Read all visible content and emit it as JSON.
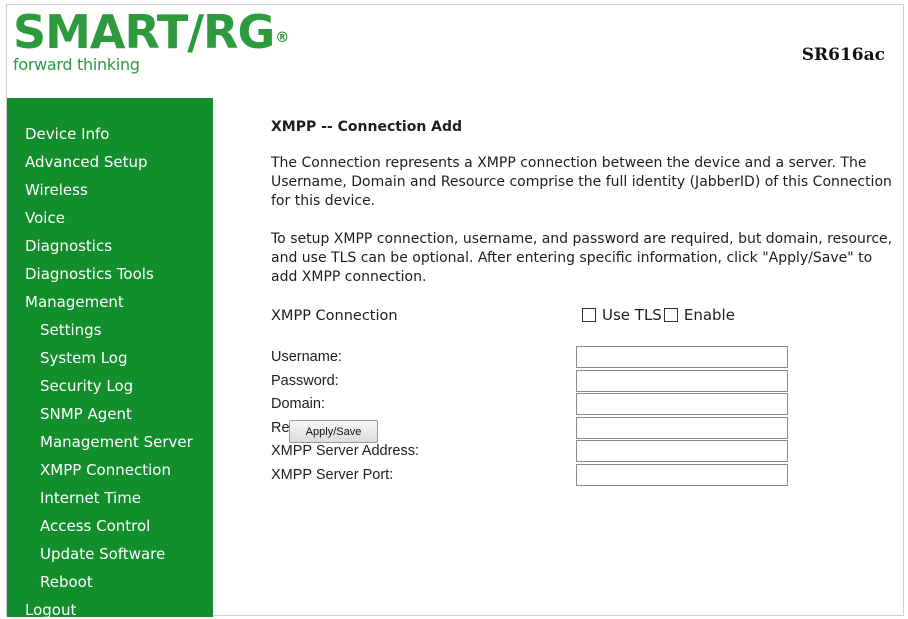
{
  "header": {
    "logo_text": "SMART/RG",
    "logo_mark": "®",
    "tagline": "forward thinking",
    "model": "SR616ac"
  },
  "sidebar": {
    "items": [
      {
        "label": "Device Info",
        "level": 0
      },
      {
        "label": "Advanced Setup",
        "level": 0
      },
      {
        "label": "Wireless",
        "level": 0
      },
      {
        "label": "Voice",
        "level": 0
      },
      {
        "label": "Diagnostics",
        "level": 0
      },
      {
        "label": "Diagnostics Tools",
        "level": 0
      },
      {
        "label": "Management",
        "level": 0
      },
      {
        "label": "Settings",
        "level": 1
      },
      {
        "label": "System Log",
        "level": 1
      },
      {
        "label": "Security Log",
        "level": 1
      },
      {
        "label": "SNMP Agent",
        "level": 1
      },
      {
        "label": "Management Server",
        "level": 1
      },
      {
        "label": "XMPP Connection",
        "level": 1
      },
      {
        "label": "Internet Time",
        "level": 1
      },
      {
        "label": "Access Control",
        "level": 1
      },
      {
        "label": "Update Software",
        "level": 1
      },
      {
        "label": "Reboot",
        "level": 1
      },
      {
        "label": "Logout",
        "level": 0
      }
    ]
  },
  "main": {
    "title": "XMPP -- Connection Add",
    "paragraph1": "The Connection represents a XMPP connection between the device and a server. The Username, Domain and Resource comprise the full identity (JabberID) of this Connection for this device.",
    "paragraph2": "To setup XMPP connection, username, and password are required, but domain, resource, and use TLS can be optional. After entering specific information, click \"Apply/Save\" to add XMPP connection.",
    "connection_label": "XMPP Connection",
    "use_tls_label": "Use TLS",
    "use_tls_checked": false,
    "enable_label": "Enable",
    "enable_checked": false,
    "fields": [
      {
        "label": "Username:",
        "value": ""
      },
      {
        "label": "Password:",
        "value": ""
      },
      {
        "label": "Domain:",
        "value": ""
      },
      {
        "label": "Resource:",
        "value": ""
      },
      {
        "label": "XMPP Server Address:",
        "value": ""
      },
      {
        "label": "XMPP Server Port:",
        "value": ""
      }
    ],
    "apply_label": "Apply/Save"
  },
  "colors": {
    "brand_green": "#2e9a3e",
    "sidebar_green": "#128e2c"
  }
}
